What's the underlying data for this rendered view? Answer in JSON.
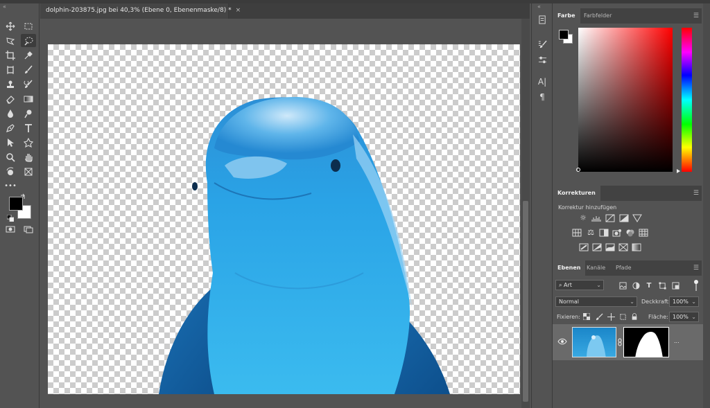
{
  "document": {
    "tab_title": "dolphin-203875.jpg bei 40,3% (Ebene 0, Ebenenmaske/8) *",
    "close_glyph": "×"
  },
  "toolbar": {
    "collapse": "«",
    "tools": [
      "move-icon",
      "marquee-icon",
      "polygon-lasso-icon",
      "quick-selection-icon",
      "crop-icon",
      "eyedropper-icon",
      "frame-icon",
      "brush-icon",
      "stamp-icon",
      "history-brush-icon",
      "eraser-icon",
      "gradient-icon",
      "blur-icon",
      "dodge-icon",
      "pen-icon",
      "type-icon",
      "path-selection-icon",
      "shape-icon",
      "zoom-icon",
      "hand-icon",
      "rotate-view-icon",
      "artboard-icon",
      "more-tools-icon"
    ],
    "active_tool": "quick-selection-icon",
    "foreground_color": "#000000",
    "background_color": "#ffffff"
  },
  "midcolumn": {
    "collapse": "«",
    "icons": [
      "history-icon",
      "brush-settings-icon",
      "adjustments-sliders-icon",
      "character-icon",
      "paragraph-icon"
    ],
    "character_glyph": "A|",
    "paragraph_glyph": "¶"
  },
  "color_panel": {
    "tabs": [
      "Farbe",
      "Farbfelder"
    ],
    "active_tab": "Farbe",
    "hue_color": "#ff0000"
  },
  "adjustments_panel": {
    "tab": "Korrekturen",
    "subtitle": "Korrektur hinzufügen",
    "row1": [
      "brightness-icon",
      "levels-icon",
      "curves-icon",
      "exposure-icon",
      "vibrance-icon"
    ],
    "row2": [
      "hue-saturation-icon",
      "color-balance-icon",
      "black-white-icon",
      "photo-filter-icon",
      "channel-mixer-icon",
      "color-lookup-icon"
    ],
    "row3": [
      "invert-icon",
      "posterize-icon",
      "threshold-icon",
      "selective-color-icon",
      "gradient-map-icon"
    ]
  },
  "layers_panel": {
    "tabs": [
      "Ebenen",
      "Kanäle",
      "Pfade"
    ],
    "active_tab": "Ebenen",
    "filter_label": "Art",
    "blend_mode": "Normal",
    "opacity_label": "Deckkraft:",
    "opacity_value": "100%",
    "lock_label": "Fixieren:",
    "fill_label": "Fläche:",
    "fill_value": "100%",
    "layer": {
      "more": "..."
    }
  },
  "accent": {
    "panel_bg": "#535353",
    "dark_bg": "#424242",
    "layer_selected_bg": "#6a6a6a"
  }
}
